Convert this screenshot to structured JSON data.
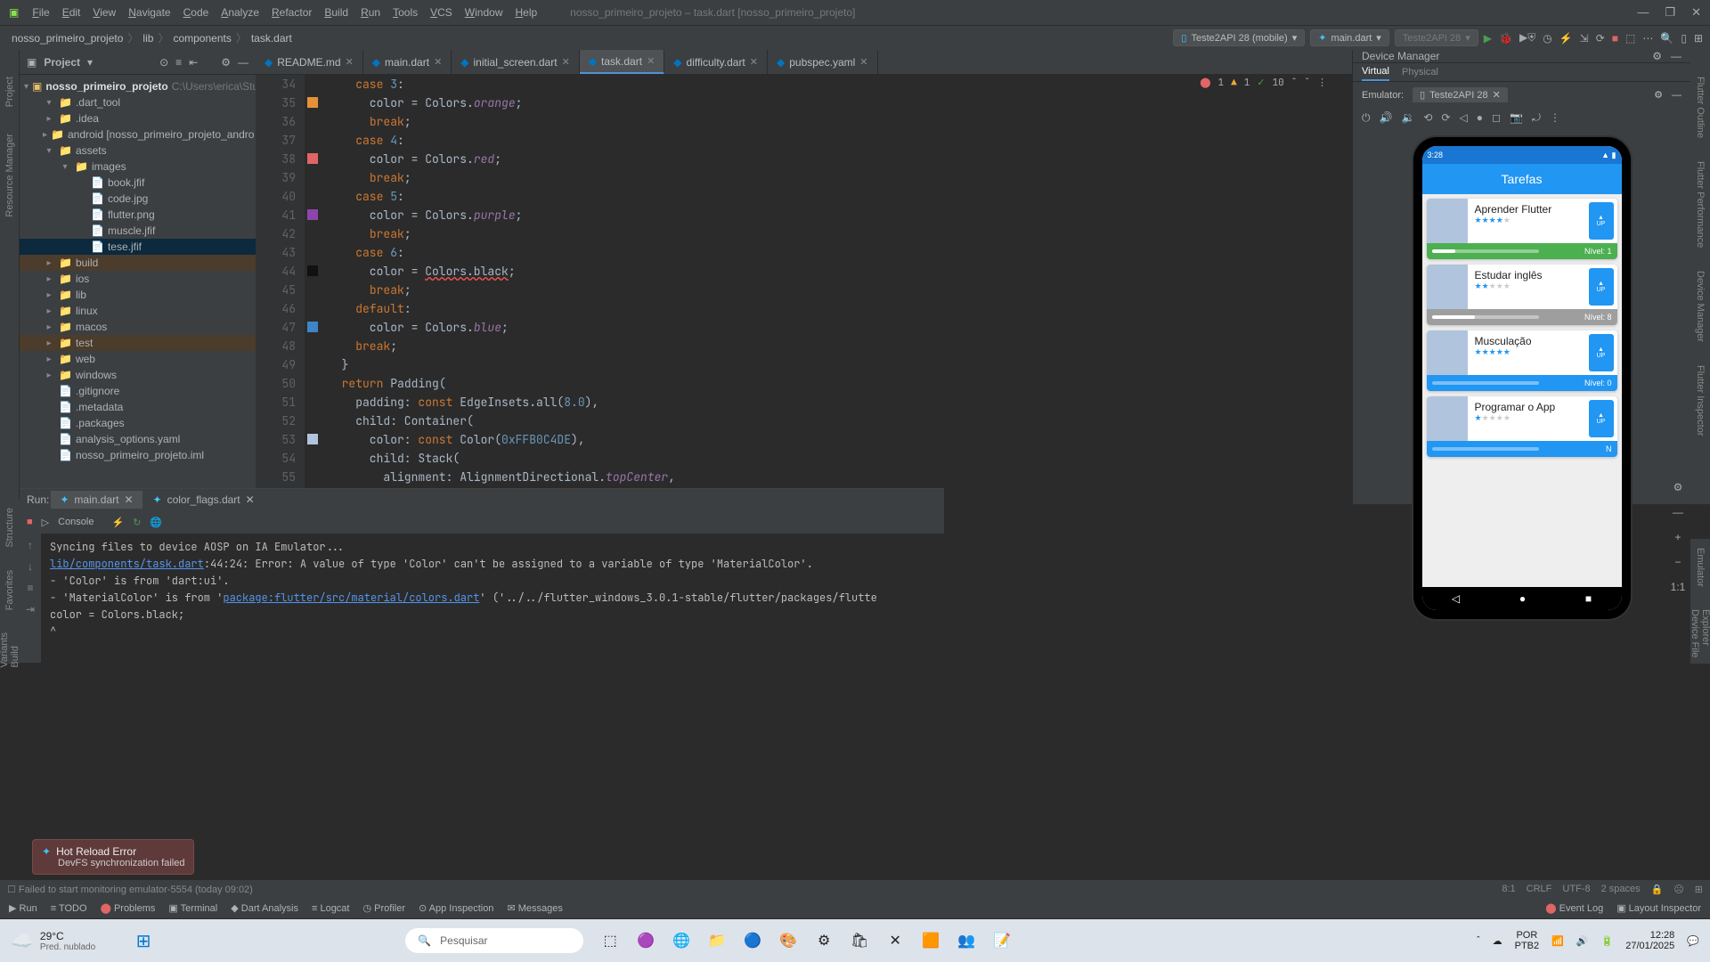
{
  "window": {
    "title": "nosso_primeiro_projeto – task.dart [nosso_primeiro_projeto]"
  },
  "menu": [
    "File",
    "Edit",
    "View",
    "Navigate",
    "Code",
    "Analyze",
    "Refactor",
    "Build",
    "Run",
    "Tools",
    "VCS",
    "Window",
    "Help"
  ],
  "breadcrumb": [
    "nosso_primeiro_projeto",
    "lib",
    "components",
    "task.dart"
  ],
  "toolbar": {
    "device": "Teste2API 28 (mobile)",
    "config": "main.dart",
    "target": "Teste2API 28"
  },
  "project_panel": {
    "title": "Project",
    "root": "nosso_primeiro_projeto",
    "root_path": "C:\\Users\\erica\\Stu",
    "items": [
      {
        "depth": 1,
        "arrow": "▾",
        "label": ".dart_tool",
        "kind": "folder"
      },
      {
        "depth": 1,
        "arrow": "▸",
        "label": ".idea",
        "kind": "folder"
      },
      {
        "depth": 1,
        "arrow": "▸",
        "label": "android [nosso_primeiro_projeto_andro",
        "kind": "folder"
      },
      {
        "depth": 1,
        "arrow": "▾",
        "label": "assets",
        "kind": "folder"
      },
      {
        "depth": 2,
        "arrow": "▾",
        "label": "images",
        "kind": "folder"
      },
      {
        "depth": 3,
        "arrow": "",
        "label": "book.jfif",
        "kind": "file"
      },
      {
        "depth": 3,
        "arrow": "",
        "label": "code.jpg",
        "kind": "file"
      },
      {
        "depth": 3,
        "arrow": "",
        "label": "flutter.png",
        "kind": "file"
      },
      {
        "depth": 3,
        "arrow": "",
        "label": "muscle.jfif",
        "kind": "file"
      },
      {
        "depth": 3,
        "arrow": "",
        "label": "tese.jfif",
        "kind": "file",
        "sel": true
      },
      {
        "depth": 1,
        "arrow": "▸",
        "label": "build",
        "kind": "folder",
        "hl": true
      },
      {
        "depth": 1,
        "arrow": "▸",
        "label": "ios",
        "kind": "folder"
      },
      {
        "depth": 1,
        "arrow": "▸",
        "label": "lib",
        "kind": "folder"
      },
      {
        "depth": 1,
        "arrow": "▸",
        "label": "linux",
        "kind": "folder"
      },
      {
        "depth": 1,
        "arrow": "▸",
        "label": "macos",
        "kind": "folder"
      },
      {
        "depth": 1,
        "arrow": "▸",
        "label": "test",
        "kind": "folder",
        "hl": true
      },
      {
        "depth": 1,
        "arrow": "▸",
        "label": "web",
        "kind": "folder"
      },
      {
        "depth": 1,
        "arrow": "▸",
        "label": "windows",
        "kind": "folder"
      },
      {
        "depth": 1,
        "arrow": "",
        "label": ".gitignore",
        "kind": "file"
      },
      {
        "depth": 1,
        "arrow": "",
        "label": ".metadata",
        "kind": "file"
      },
      {
        "depth": 1,
        "arrow": "",
        "label": ".packages",
        "kind": "file"
      },
      {
        "depth": 1,
        "arrow": "",
        "label": "analysis_options.yaml",
        "kind": "file"
      },
      {
        "depth": 1,
        "arrow": "",
        "label": "nosso_primeiro_projeto.iml",
        "kind": "file"
      }
    ]
  },
  "editor_tabs": [
    {
      "label": "README.md"
    },
    {
      "label": "main.dart"
    },
    {
      "label": "initial_screen.dart"
    },
    {
      "label": "task.dart",
      "active": true
    },
    {
      "label": "difficulty.dart"
    },
    {
      "label": "pubspec.yaml"
    }
  ],
  "error_indicators": {
    "errors": "1",
    "warnings": "1",
    "passes": "10"
  },
  "code_lines": [
    {
      "n": 34,
      "html": "    <span class='kw'>case</span> <span class='num'>3</span>:"
    },
    {
      "n": 35,
      "html": "      color = Colors.<span class='prop'>orange</span>;",
      "marker": "#e69138"
    },
    {
      "n": 36,
      "html": "      <span class='kw'>break</span>;"
    },
    {
      "n": 37,
      "html": "    <span class='kw'>case</span> <span class='num'>4</span>:"
    },
    {
      "n": 38,
      "html": "      color = Colors.<span class='prop'>red</span>;",
      "marker": "#e06666"
    },
    {
      "n": 39,
      "html": "      <span class='kw'>break</span>;"
    },
    {
      "n": 40,
      "html": "    <span class='kw'>case</span> <span class='num'>5</span>:"
    },
    {
      "n": 41,
      "html": "      color = Colors.<span class='prop'>purple</span>;",
      "marker": "#8e44ad"
    },
    {
      "n": 42,
      "html": "      <span class='kw'>break</span>;"
    },
    {
      "n": 43,
      "html": "    <span class='kw'>case</span> <span class='num'>6</span>:"
    },
    {
      "n": 44,
      "html": "      color = <span class='err-line'>Colors.black</span>;",
      "marker": "#111111"
    },
    {
      "n": 45,
      "html": "      <span class='kw'>break</span>;"
    },
    {
      "n": 46,
      "html": "    <span class='kw'>default</span>:"
    },
    {
      "n": 47,
      "html": "      color = Colors.<span class='prop'>blue</span>;",
      "marker": "#3d85c6"
    },
    {
      "n": 48,
      "html": "    <span class='kw'>break</span>;"
    },
    {
      "n": 49,
      "html": "  }"
    },
    {
      "n": 50,
      "html": "  <span class='kw'>return</span> Padding("
    },
    {
      "n": 51,
      "html": "    padding: <span class='kw'>const</span> EdgeInsets.all(<span class='num'>8.0</span>),"
    },
    {
      "n": 52,
      "html": "    child: Container("
    },
    {
      "n": 53,
      "html": "      color: <span class='kw'>const</span> Color(<span class='num'>0xFFB0C4DE</span>),",
      "marker": "#b0c4de"
    },
    {
      "n": 54,
      "html": "      child: Stack("
    },
    {
      "n": 55,
      "html": "        alignment: AlignmentDirectional.<span class='prop'>topCenter</span>,"
    }
  ],
  "run_panel": {
    "tab1": "main.dart",
    "tab2": "color_flags.dart",
    "console_label": "Console",
    "lines": [
      {
        "txt": "Syncing files to device AOSP on IA Emulator..."
      },
      {
        "html": "<span class='blue'>lib/components/task.dart</span>:44:24: Error: A value of type 'Color' can't be assigned to a variable of type 'MaterialColor'."
      },
      {
        "txt": " - 'Color' is from 'dart:ui'."
      },
      {
        "html": " - 'MaterialColor' is from '<span class='blue'>package:flutter/src/material/colors.dart</span>' ('../../flutter_windows_3.0.1-stable/flutter/packages/flutte"
      },
      {
        "txt": "      color = Colors.black;"
      },
      {
        "txt": "              ^"
      }
    ]
  },
  "hot_reload": {
    "title": "Hot Reload Error",
    "sub": "DevFS synchronization failed"
  },
  "bottom_strip": {
    "run": "Run",
    "todo": "TODO",
    "problems": "Problems",
    "terminal": "Terminal",
    "dart": "Dart Analysis",
    "logcat": "Logcat",
    "profiler": "Profiler",
    "app_insp": "App Inspection",
    "messages": "Messages",
    "event_log": "Event Log",
    "layout_insp": "Layout Inspector"
  },
  "status_bar": {
    "msg": "Failed to start monitoring emulator-5554 (today 09:02)",
    "pos": "8:1",
    "encoding": "CRLF",
    "charset": "UTF-8",
    "indent": "2 spaces"
  },
  "device_manager": {
    "title": "Device Manager",
    "virtual": "Virtual",
    "physical": "Physical",
    "emulator_label": "Emulator:",
    "emulator_tab": "Teste2API 28"
  },
  "phone": {
    "time": "3:28",
    "app_title": "Tarefas",
    "tasks": [
      {
        "title": "Aprender Flutter",
        "stars": 4,
        "level": "Nível: 1",
        "color": "#4caf50",
        "progress": 22
      },
      {
        "title": "Estudar inglês",
        "stars": 2,
        "level": "Nível: 8",
        "color": "#9e9e9e",
        "progress": 40
      },
      {
        "title": "Musculação",
        "stars": 5,
        "level": "Nível: 0",
        "color": "#2196f3",
        "progress": 0
      },
      {
        "title": "Programar o App",
        "stars": 1,
        "level": "N",
        "color": "#2196f3",
        "progress": 0
      }
    ],
    "up": "UP"
  },
  "win_taskbar": {
    "temp": "29°C",
    "weather": "Pred. nublado",
    "search": "Pesquisar",
    "kbd": "POR",
    "kbd2": "PTB2",
    "time": "12:28",
    "date": "27/01/2025"
  }
}
